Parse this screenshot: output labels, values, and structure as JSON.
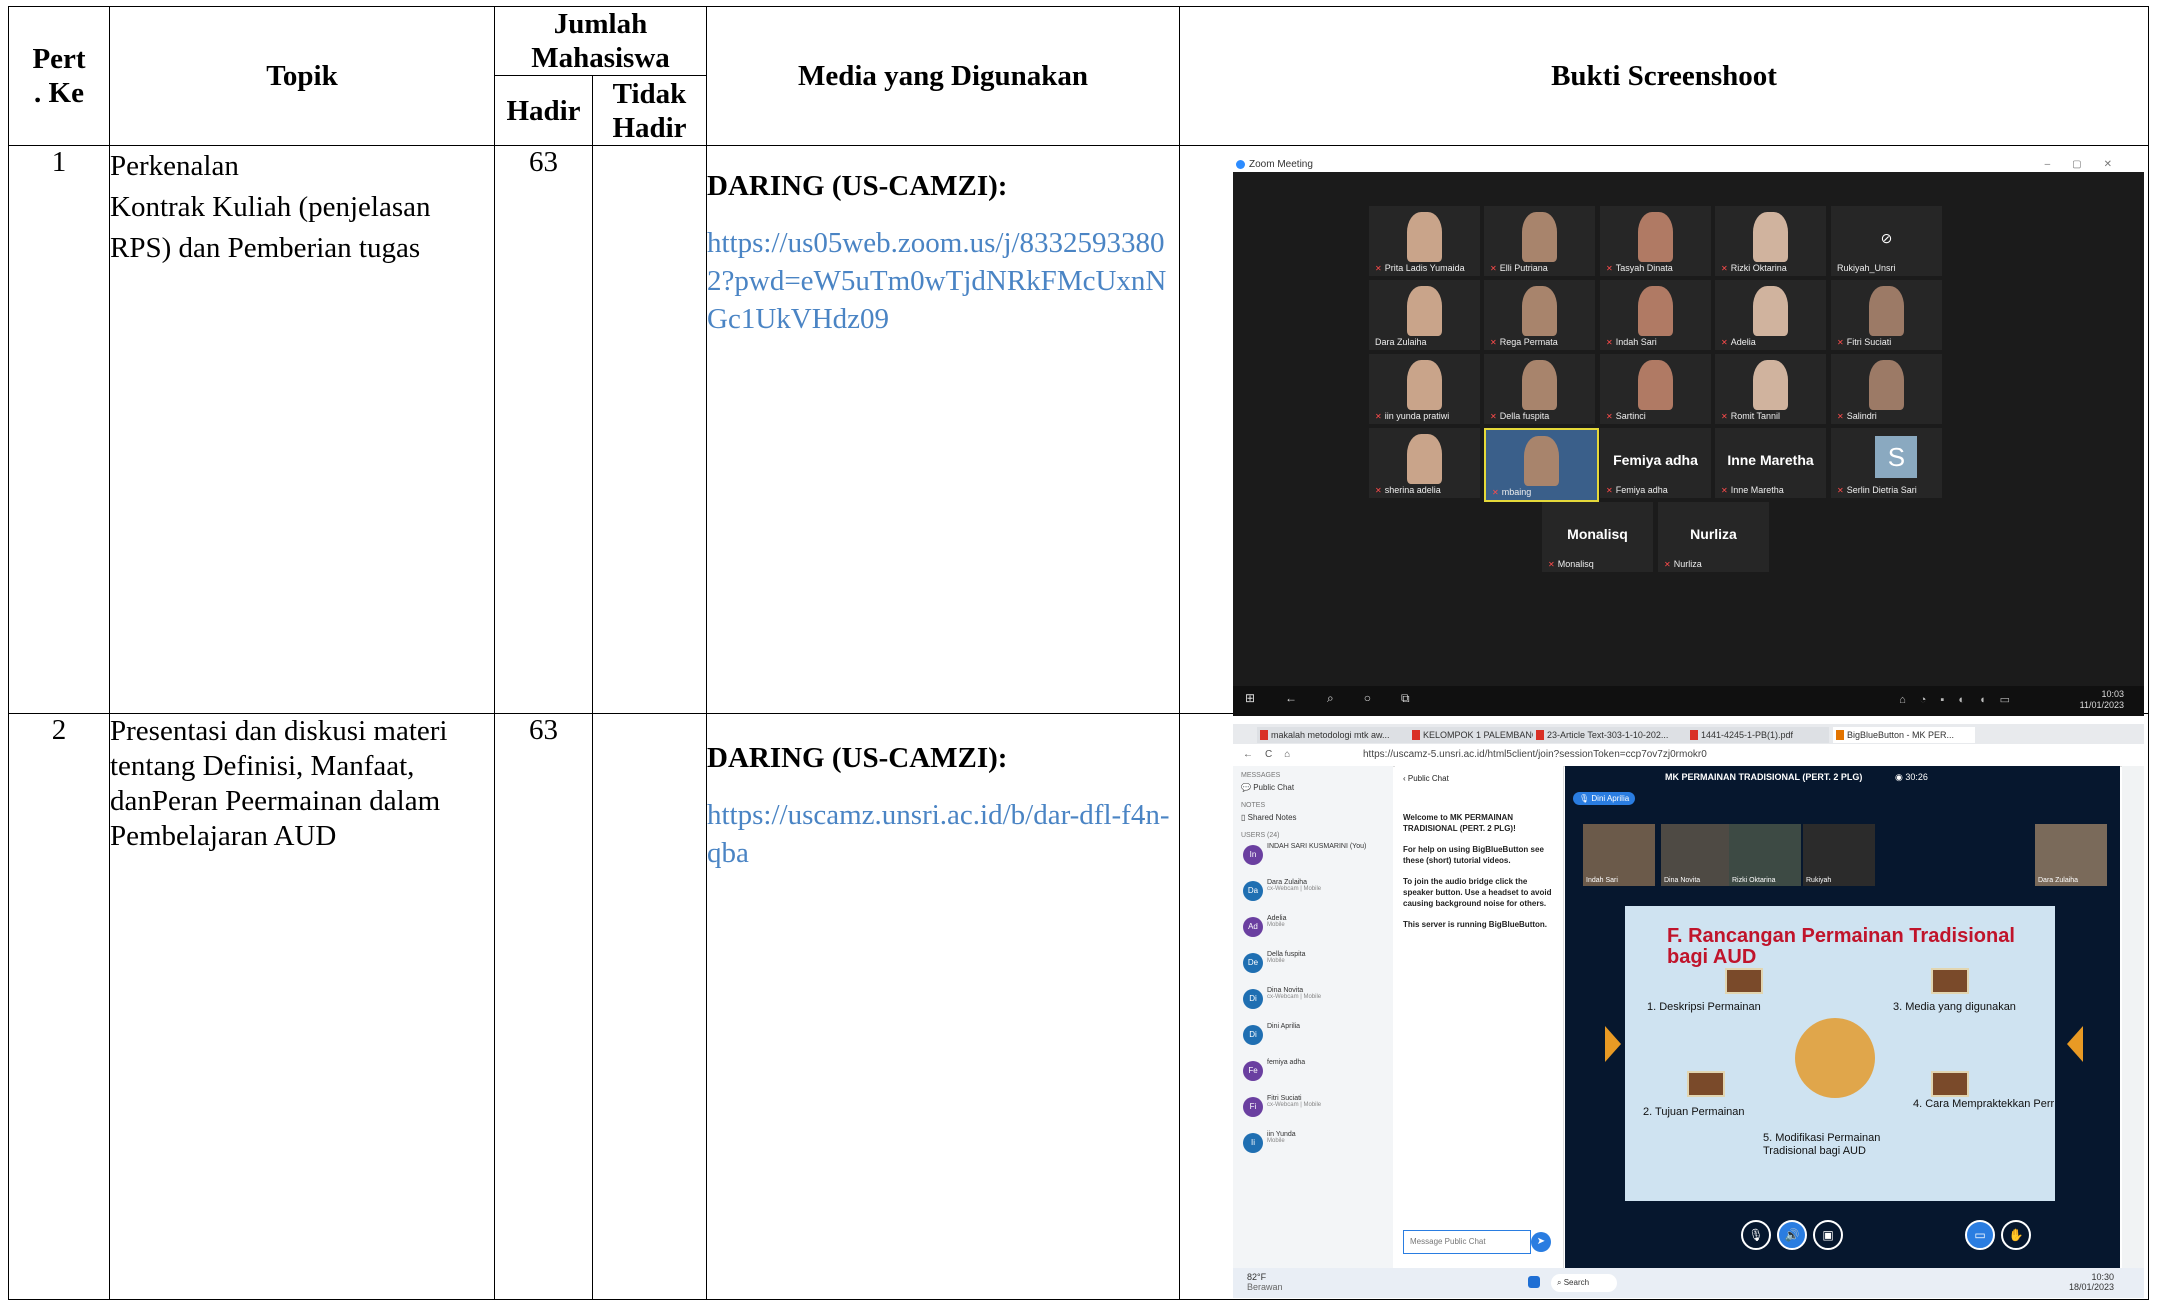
{
  "headers": {
    "pert": "Pert\n. Ke",
    "topik": "Topik",
    "jumlah": "Jumlah\nMahasiswa",
    "hadir": "Hadir",
    "tidak_hadir": "Tidak\nHadir",
    "media": "Media yang Digunakan",
    "bukti": "Bukti Screenshoot"
  },
  "rows": [
    {
      "no": "1",
      "topik_1": "Perkenalan",
      "topik_2": "Kontrak Kuliah (penjelasan RPS) dan Pemberian tugas",
      "hadir": "63",
      "tidak": "",
      "media_label": "DARING (US-CAMZI):",
      "media_link": "https://us05web.zoom.us/j/83325933802?pwd=eW5uTm0wTjdNRkFMcUxnNGc1UkVHdz09"
    },
    {
      "no": "2",
      "topik_1": "Presentasi dan diskusi materi tentang Definisi, Manfaat, danPeran Peermainan dalam Pembelajaran AUD",
      "topik_2": "",
      "hadir": "63",
      "tidak": "",
      "media_label": "DARING (US-CAMZI):",
      "media_link": "https://uscamz.unsri.ac.id/b/dar-dfl-f4n-qba"
    }
  ],
  "zoom": {
    "window_title": "Zoom Meeting",
    "participants": [
      "Prita Ladis Yumaida",
      "Elli Putriana",
      "Tasyah Dinata",
      "Rizki Oktarina",
      "Rukiyah_Unsri",
      "Dara Zulaiha",
      "Rega Permata",
      "Indah Sari",
      "Adelia",
      "Fitri Suciati",
      "iin yunda pratiwi",
      "Della fuspita",
      "Sartinci",
      "Romit Tannil",
      "Salindri",
      "sherina adelia",
      "mbaing",
      "Femiya adha",
      "Inne Maretha",
      "Serlin Dietria Sari",
      "Monalisq",
      "Nurliza"
    ],
    "big_names": {
      "femiya": "Femiya adha",
      "inne": "Inne Maretha",
      "monalisq": "Monalisq",
      "nurliza": "Nurliza"
    },
    "s_avatar": "S",
    "clock_time": "10:03",
    "clock_date": "11/01/2023"
  },
  "bbb": {
    "tabs": [
      "makalah metodologi mtk aw...",
      "KELOMPOK 1 PALEMBANG_K...",
      "23-Article Text-303-1-10-202...",
      "1441-4245-1-PB(1).pdf",
      "BigBlueButton - MK PER..."
    ],
    "url": "https://uscamz-5.unsri.ac.id/html5client/join?sessionToken=ccp7ov7zj0rmokr0",
    "side": {
      "messages": "MESSAGES",
      "public_chat": "Public Chat",
      "notes": "NOTES",
      "shared_notes": "Shared Notes",
      "users": "USERS (24)"
    },
    "users": [
      {
        "ab": "In",
        "name": "INDAH SARI KUSMARINI (You)",
        "sub": "",
        "color": "#6a3fa0"
      },
      {
        "ab": "Da",
        "name": "Dara Zulaiha",
        "sub": "cx-Webcam | Mobile",
        "color": "#1f6fb2"
      },
      {
        "ab": "Ad",
        "name": "Adelia",
        "sub": "Mobile",
        "color": "#6a3fa0"
      },
      {
        "ab": "De",
        "name": "Della fuspita",
        "sub": "Mobile",
        "color": "#1f6fb2"
      },
      {
        "ab": "Di",
        "name": "Dina Novita",
        "sub": "cx-Webcam | Mobile",
        "color": "#1f6fb2"
      },
      {
        "ab": "Di",
        "name": "Dini Aprilia",
        "sub": "",
        "color": "#1f6fb2"
      },
      {
        "ab": "Fe",
        "name": "femiya adha",
        "sub": "",
        "color": "#6a3fa0"
      },
      {
        "ab": "Fi",
        "name": "Fitri Suciati",
        "sub": "cx-Webcam | Mobile",
        "color": "#6a3fa0"
      },
      {
        "ab": "Ii",
        "name": "iin Yunda",
        "sub": "Mobile",
        "color": "#1f6fb2"
      }
    ],
    "chat": {
      "header": "Public Chat",
      "w1": "Welcome to MK PERMAINAN TRADISIONAL (PERT. 2 PLG)!",
      "w2": "For help on using BigBlueButton see these (short) tutorial videos.",
      "w3": "To join the audio bridge click the speaker button. Use a headset to avoid causing background noise for others.",
      "w4": "This server is running BigBlueButton.",
      "placeholder": "Message Public Chat"
    },
    "meeting_title": "MK PERMAINAN TRADISIONAL (PERT. 2 PLG)",
    "rec_time": "30:26",
    "speaker": "Dini Aprilia",
    "cams": [
      "Indah Sari",
      "Dina Novita",
      "Rizki Oktarina",
      "Rukiyah",
      "Dara Zulaiha"
    ],
    "slide": {
      "title": "F. Rancangan Permainan Tradisional bagi AUD",
      "i1": "1. Deskripsi Permainan",
      "i2": "2. Tujuan Permainan",
      "i3": "3. Media yang digunakan",
      "i4": "4. Cara Mempraktekkan Perr",
      "i5": "5. Modifikasi Permainan Tradisional bagi AUD"
    },
    "weather_temp": "82°F",
    "weather_desc": "Berawan",
    "search": "Search",
    "clock_time": "10:30",
    "clock_date": "18/01/2023"
  }
}
